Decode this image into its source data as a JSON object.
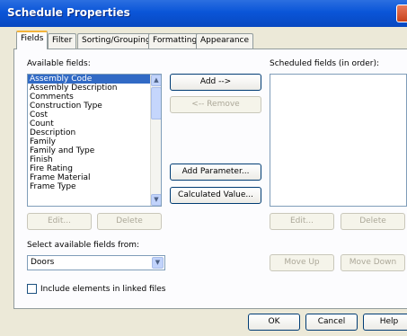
{
  "window": {
    "title": "Schedule Properties"
  },
  "tabs": [
    "Fields",
    "Filter",
    "Sorting/Grouping",
    "Formatting",
    "Appearance"
  ],
  "available_fields": {
    "label": "Available fields:",
    "items": [
      "Assembly Code",
      "Assembly Description",
      "Comments",
      "Construction Type",
      "Cost",
      "Count",
      "Description",
      "Family",
      "Family and Type",
      "Finish",
      "Fire Rating",
      "Frame Material",
      "Frame Type"
    ],
    "selected_index": 0
  },
  "scheduled_fields": {
    "label": "Scheduled fields (in order):",
    "items": []
  },
  "buttons": {
    "add": "Add -->",
    "remove": "<-- Remove",
    "add_parameter": "Add Parameter...",
    "calculated_value": "Calculated Value...",
    "edit_left": "Edit...",
    "delete_left": "Delete",
    "edit_right": "Edit...",
    "delete_right": "Delete",
    "move_up": "Move Up",
    "move_down": "Move Down",
    "ok": "OK",
    "cancel": "Cancel",
    "help": "Help"
  },
  "select_from": {
    "label": "Select available fields from:",
    "value": "Doors"
  },
  "include_linked": {
    "label": "Include elements in linked files",
    "checked": false
  }
}
